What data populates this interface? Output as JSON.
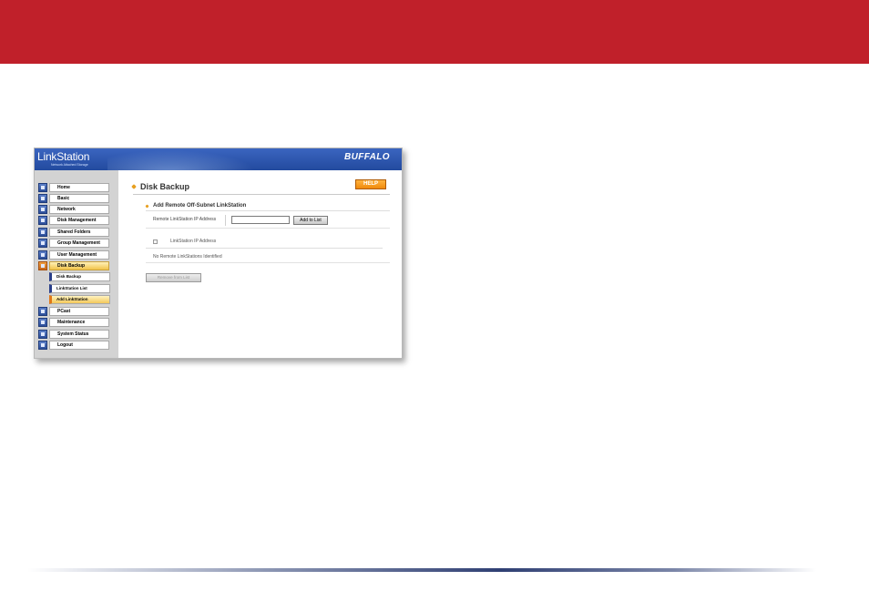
{
  "header": {
    "logo_text": "LinkStation",
    "logo_tagline": "Network Attached Storage",
    "brand": "BUFFALO"
  },
  "sidebar": {
    "items": [
      {
        "label": "Home",
        "icon": "home-icon"
      },
      {
        "label": "Basic",
        "icon": "basic-icon"
      },
      {
        "label": "Network",
        "icon": "network-icon"
      },
      {
        "label": "Disk Management",
        "icon": "disk-icon"
      },
      {
        "label": "Shared Folders",
        "icon": "folder-icon"
      },
      {
        "label": "Group Management",
        "icon": "group-icon"
      },
      {
        "label": "User Management",
        "icon": "user-icon"
      },
      {
        "label": "Disk Backup",
        "icon": "backup-icon",
        "active": true
      },
      {
        "label": "PCast",
        "icon": "pcast-icon"
      },
      {
        "label": "Maintenance",
        "icon": "maintenance-icon"
      },
      {
        "label": "System Status",
        "icon": "status-icon"
      },
      {
        "label": "Logout",
        "icon": "logout-icon"
      }
    ],
    "sub_items": [
      {
        "label": "Disk Backup"
      },
      {
        "label": "LinkStation List"
      },
      {
        "label": "Add LinkStation",
        "active": true
      }
    ]
  },
  "main": {
    "page_title": "Disk Backup",
    "help_label": "HELP",
    "section_title": "Add Remote Off-Subnet LinkStation",
    "ip_field_label": "Remote LinkStation IP Address",
    "ip_value": "",
    "add_button": "Add to List",
    "list_column": "LinkStation IP Address",
    "empty_message": "No Remote LinkStations Identified",
    "remove_button": "Remove from List"
  },
  "colors": {
    "banner_red": "#c0202a",
    "header_blue": "#234a9e",
    "active_orange": "#f2c44a",
    "help_orange": "#f08a0a"
  }
}
